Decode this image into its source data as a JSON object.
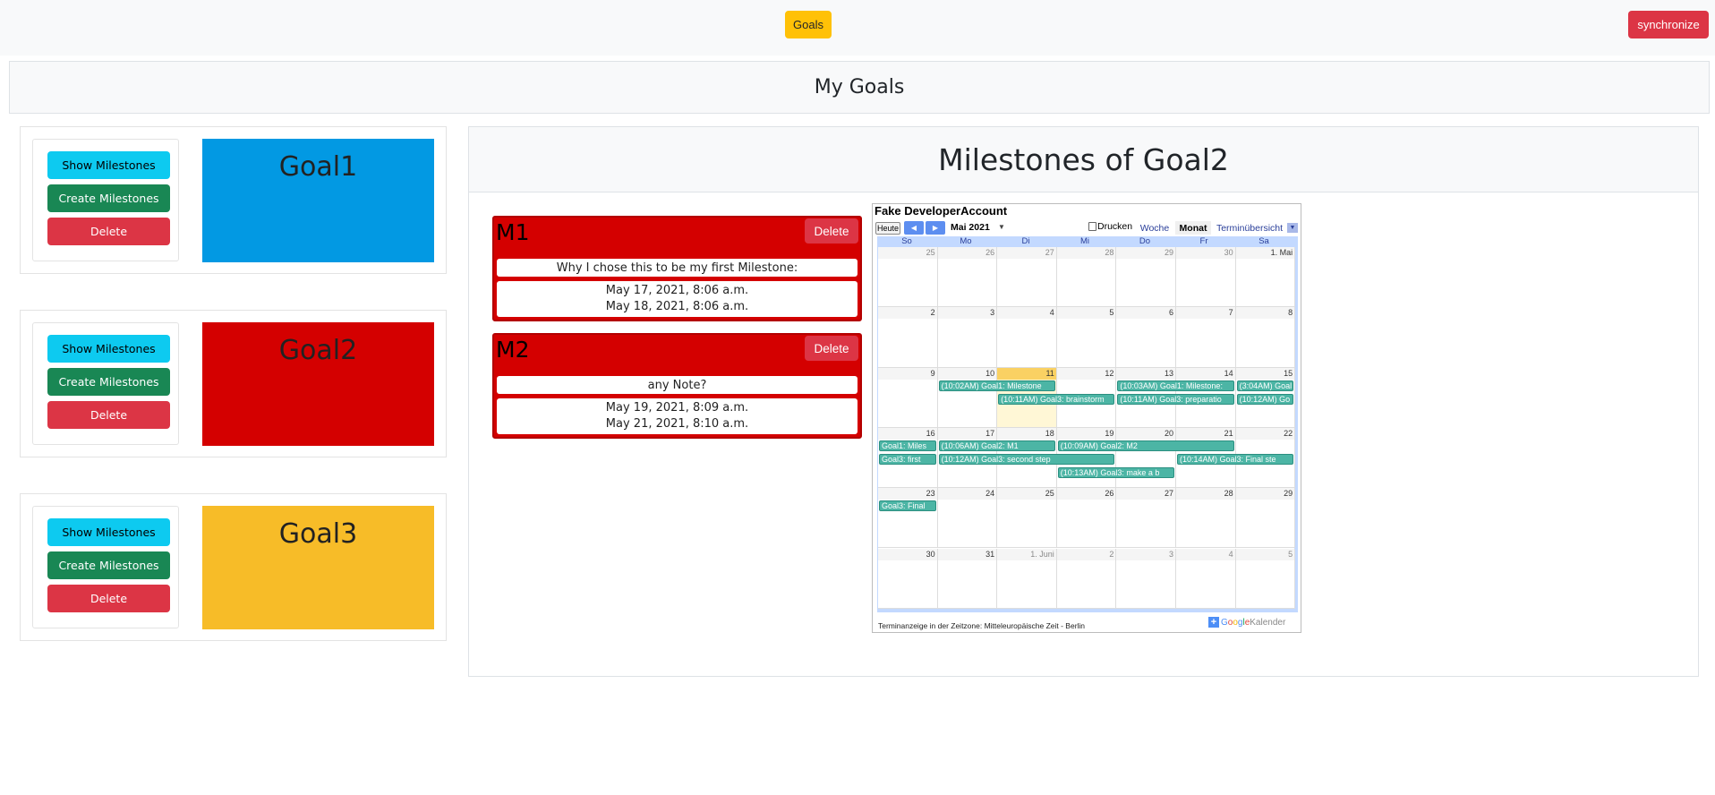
{
  "navbar": {
    "goals_label": "Goals",
    "sync_label": "synchronize"
  },
  "page": {
    "title": "My Goals"
  },
  "colors": {
    "goal1": "#0299e3",
    "goal2": "#d40000",
    "goal3": "#f7bc28",
    "milestone_card": "#d40000",
    "event": "#4cb5a5"
  },
  "goals": [
    {
      "name": "Goal1",
      "show_label": "Show Milestones",
      "create_label": "Create Milestones",
      "delete_label": "Delete"
    },
    {
      "name": "Goal2",
      "show_label": "Show Milestones",
      "create_label": "Create Milestones",
      "delete_label": "Delete"
    },
    {
      "name": "Goal3",
      "show_label": "Show Milestones",
      "create_label": "Create Milestones",
      "delete_label": "Delete"
    }
  ],
  "milestones_panel": {
    "title": "Milestones of Goal2",
    "milestones": [
      {
        "name": "M1",
        "delete_label": "Delete",
        "note": "Why I chose this to be my first Milestone:",
        "start": "May 17, 2021, 8:06 a.m.",
        "end": "May 18, 2021, 8:06 a.m."
      },
      {
        "name": "M2",
        "delete_label": "Delete",
        "note": "any Note?",
        "start": "May 19, 2021, 8:09 a.m.",
        "end": "May 21, 2021, 8:10 a.m."
      }
    ]
  },
  "calendar": {
    "title": "Fake DeveloperAccount",
    "today_label": "Heute",
    "prev_icon": "chevron-left-icon",
    "next_icon": "chevron-right-icon",
    "month_label": "Mai 2021",
    "print_label": "Drucken",
    "week_label": "Woche",
    "month_view_label": "Monat",
    "agenda_label": "Terminübersicht",
    "weekdays": [
      "So",
      "Mo",
      "Di",
      "Mi",
      "Do",
      "Fr",
      "Sa"
    ],
    "weeks": [
      [
        "25",
        "26",
        "27",
        "28",
        "29",
        "30",
        "1. Mai"
      ],
      [
        "2",
        "3",
        "4",
        "5",
        "6",
        "7",
        "8"
      ],
      [
        "9",
        "10",
        "11",
        "12",
        "13",
        "14",
        "15"
      ],
      [
        "16",
        "17",
        "18",
        "19",
        "20",
        "21",
        "22"
      ],
      [
        "23",
        "24",
        "25",
        "26",
        "27",
        "28",
        "29"
      ],
      [
        "30",
        "31",
        "1. Juni",
        "2",
        "3",
        "4",
        "5"
      ]
    ],
    "events": [
      {
        "text": "(10:02AM) Goal1: Milestone"
      },
      {
        "text": "(10:11AM) Goal3: brainstorm"
      },
      {
        "text": "(10:03AM) Goal1: Milestone:"
      },
      {
        "text": "(10:11AM) Goal3: preparatio"
      },
      {
        "text": "(3:04AM) Goal"
      },
      {
        "text": "(10:12AM) Go"
      },
      {
        "text": "Goal1: Miles"
      },
      {
        "text": "(10:06AM) Goal2: M1"
      },
      {
        "text": "(10:09AM) Goal2: M2"
      },
      {
        "text": "Goal3: first"
      },
      {
        "text": "(10:12AM) Goal3: second step"
      },
      {
        "text": "(10:14AM) Goal3: Final ste"
      },
      {
        "text": "(10:13AM) Goal3: make a b"
      },
      {
        "text": "Goal3: Final"
      }
    ],
    "footer": "Terminanzeige in der Zeitzone: Mitteleuropäische Zeit - Berlin",
    "gcal_logo": "Google Kalender"
  }
}
